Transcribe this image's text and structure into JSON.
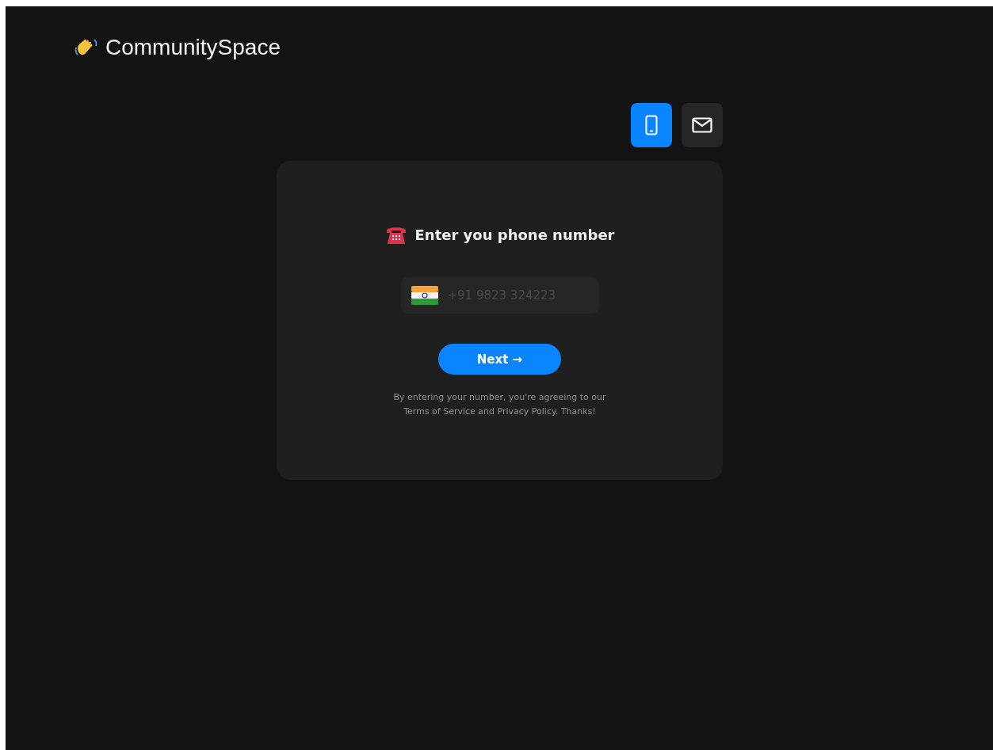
{
  "brand": {
    "name": "CommunitySpace"
  },
  "tabs": [
    {
      "kind": "phone",
      "selected": true
    },
    {
      "kind": "email",
      "selected": false
    }
  ],
  "form": {
    "title": "Enter you phone number",
    "placeholder": "+91 9823 324223",
    "button": "Next →",
    "disclaimer": "By entering your number, you're agreeing to our Terms of Service and Privacy Policy. Thanks!"
  }
}
